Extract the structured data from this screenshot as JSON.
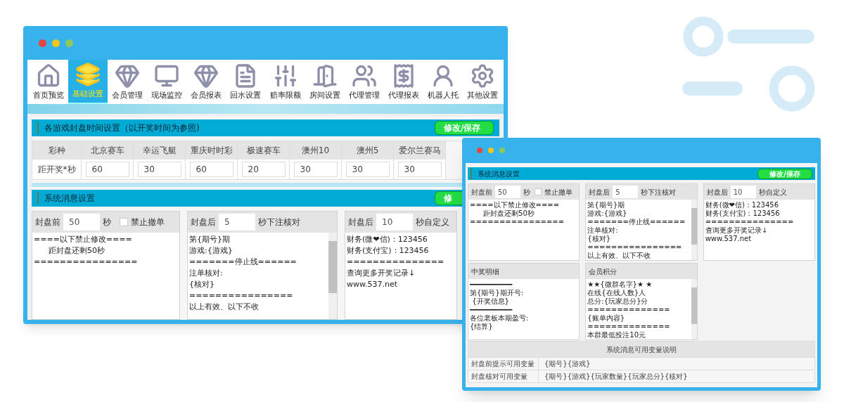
{
  "main_window": {
    "nav": [
      {
        "label": "首页预览",
        "selected": false
      },
      {
        "label": "基础设置",
        "selected": true
      },
      {
        "label": "会员管理",
        "selected": false
      },
      {
        "label": "现场监控",
        "selected": false
      },
      {
        "label": "会员报表",
        "selected": false
      },
      {
        "label": "回水设置",
        "selected": false
      },
      {
        "label": "赔率限额",
        "selected": false
      },
      {
        "label": "房间设置",
        "selected": false
      },
      {
        "label": "代理管理",
        "selected": false
      },
      {
        "label": "代理报表",
        "selected": false
      },
      {
        "label": "机器人托",
        "selected": false
      },
      {
        "label": "其他设置",
        "selected": false
      }
    ],
    "closing_times": {
      "title": "各游戏封盘时间设置（以开奖时间为参照)",
      "button": "修改/保存",
      "columns": [
        "彩种",
        "北京赛车",
        "幸运飞艇",
        "重庆时时彩",
        "极速赛车",
        "澳州10",
        "澳州5",
        "爱尔兰赛马"
      ],
      "row_label": "距开奖*秒",
      "values": [
        "60",
        "30",
        "60",
        "20",
        "30",
        "30",
        "30"
      ]
    },
    "system_messages": {
      "title": "系统消息设置",
      "button": "修",
      "panels": [
        {
          "kind": "plain",
          "label_before": "封盘前",
          "value": "50",
          "label_after": "秒",
          "checkbox": {
            "label": "禁止撤单",
            "checked": false
          },
          "lines": [
            "====以下禁止修改====",
            "      距封盘还剩50秒",
            "================"
          ]
        },
        {
          "kind": "scroll",
          "label_before": "封盘后",
          "value": "5",
          "label_after": "秒下注核对",
          "lines": [
            "第{期号}期",
            "游戏:{游戏}",
            "=======停止线======",
            "注单核对:",
            "{核对}",
            "================",
            "以上有效、以下不收"
          ]
        },
        {
          "kind": "plain",
          "label_before": "封盘后",
          "value": "10",
          "label_after": "秒自定义",
          "lines": [
            "财务(微❤信)：123456",
            "财务(支付宝)：123456",
            "===============",
            "查询更多开奖记录↓",
            "www.537.net"
          ]
        }
      ]
    }
  },
  "popup_window": {
    "title": "系统消息设置",
    "button": "修改/保存",
    "panels": [
      {
        "kind": "plain",
        "label_before": "封盘前",
        "value": "50",
        "label_after": "秒",
        "checkbox": {
          "label": "禁止撤单",
          "checked": false
        },
        "lines": [
          "====以下禁止修改====",
          "      距封盘还剩50秒",
          "================"
        ]
      },
      {
        "kind": "scroll",
        "label_before": "封盘后",
        "value": "5",
        "label_after": "秒下注核对",
        "lines": [
          "第{期号}期",
          "游戏:{游戏}",
          "=======停止线======",
          "注单核对:",
          "{核对}",
          "================",
          "以上有效、以下不收"
        ]
      },
      {
        "kind": "plain",
        "label_before": "封盘后",
        "value": "10",
        "label_after": "秒自定义",
        "lines": [
          "财务(微❤信)：123456",
          "财务(支付宝)：123456",
          "===============",
          "查询更多开奖记录↓",
          "www.537.net"
        ]
      },
      {
        "kind": "plain",
        "label_before": "中奖明细",
        "lines": [
          "━━━━━━━━━━",
          "第{期号}期开号:",
          " {开奖信息}",
          "━━━━━━━━━━",
          "各位老板本期盈亏:",
          "{结算}"
        ]
      },
      {
        "kind": "scroll",
        "label_before": "会员积分",
        "lines": [
          "★★{微群名字}★ ★",
          "在线{在线人数}人",
          "总分:{玩家总分}分",
          "==============",
          "{账单内容}",
          "==============",
          "本群最低投注10元"
        ]
      }
    ],
    "variables_table": {
      "title": "系统消息可用变量说明",
      "rows": [
        {
          "name": "封盘前提示可用变量",
          "value": "{期号}{游戏}"
        },
        {
          "name": "封盘核对可用变量",
          "value": "{期号}{游戏}{玩家数量}{玩家总分}{核对}"
        }
      ]
    }
  }
}
